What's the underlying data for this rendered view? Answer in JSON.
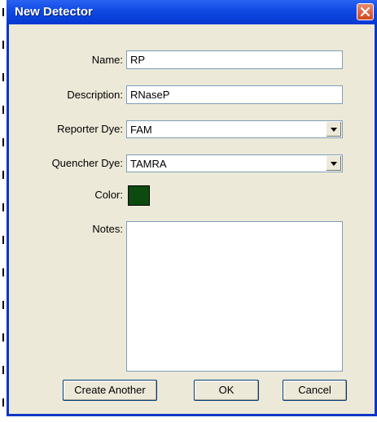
{
  "window": {
    "title": "New Detector"
  },
  "form": {
    "name_label": "Name:",
    "name_value": "RP",
    "description_label": "Description:",
    "description_value": "RNaseP",
    "reporter_label": "Reporter Dye:",
    "reporter_value": "FAM",
    "quencher_label": "Quencher Dye:",
    "quencher_value": "TAMRA",
    "color_label": "Color:",
    "color_value": "#0c4a0f",
    "notes_label": "Notes:",
    "notes_value": ""
  },
  "buttons": {
    "create_another": "Create Another",
    "ok": "OK",
    "cancel": "Cancel"
  },
  "theme": {
    "title_bar": "#0a46df",
    "close_button": "#d9532b",
    "dialog_face": "#ece9d8"
  }
}
